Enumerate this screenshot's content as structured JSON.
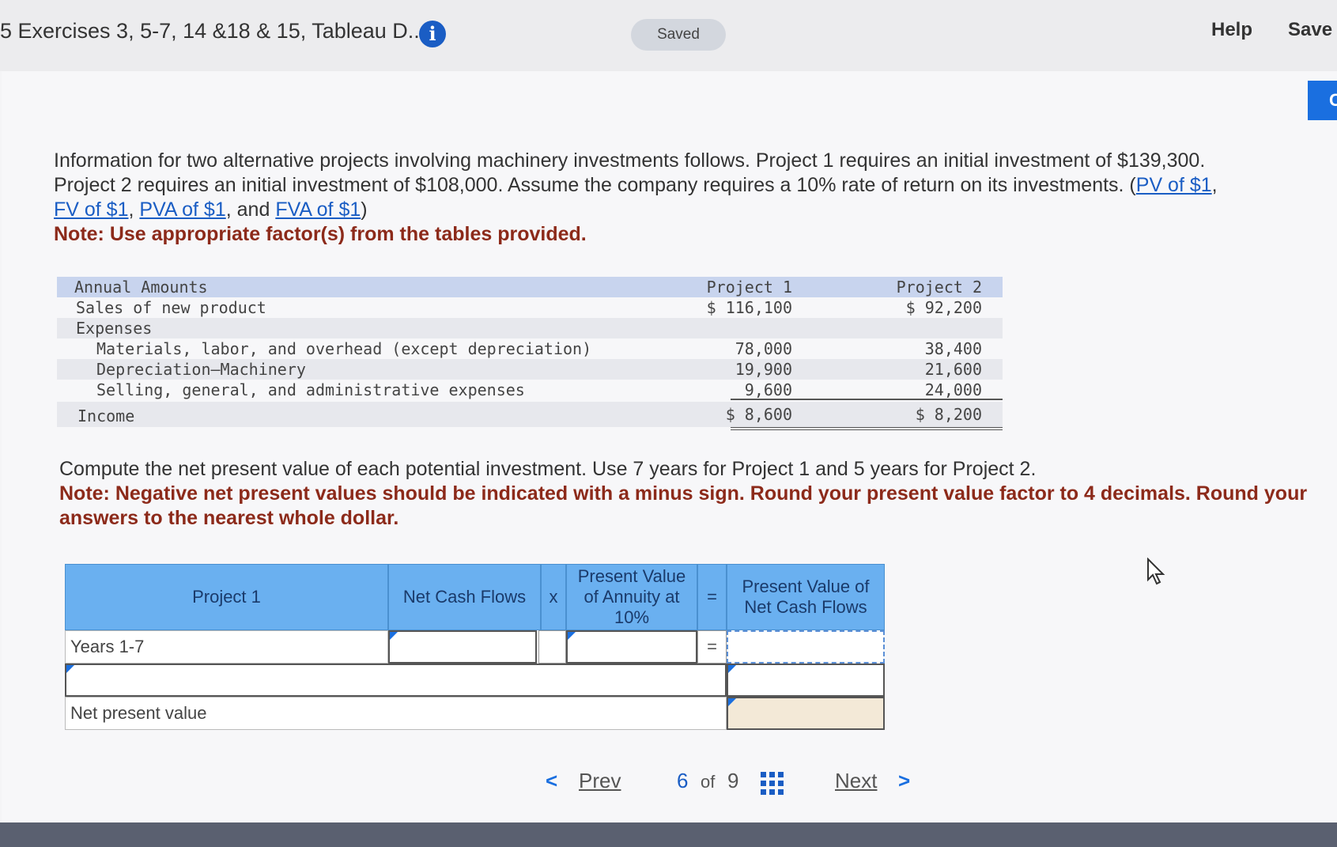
{
  "header": {
    "title": "5 Exercises 3, 5-7, 14 &18 & 15, Tableau D...",
    "saved_label": "Saved",
    "help_label": "Help",
    "save_label": "Save",
    "tab_edge_letter": "C"
  },
  "intro": {
    "text1": "Information for two alternative projects involving machinery investments follows. Project 1 requires an initial investment of $139,300.",
    "text2": "Project 2 requires an initial investment of $108,000. Assume the company requires a 10% rate of return on its investments. (",
    "link_pv": "PV of $1",
    "sep1": ", ",
    "link_fv": "FV of $1",
    "sep2": ", ",
    "link_pva": "PVA of $1",
    "sep3": ", and ",
    "link_fva": "FVA of $1",
    "close": ")",
    "note": "Note: Use appropriate factor(s) from the tables provided."
  },
  "annual_table": {
    "header": {
      "label": "Annual Amounts",
      "col1": "Project 1",
      "col2": "Project 2"
    },
    "rows": [
      {
        "label": "Sales of new product",
        "v1": "$ 116,100",
        "v2": "$ 92,200"
      },
      {
        "label": "Expenses",
        "v1": "",
        "v2": ""
      },
      {
        "label": "Materials, labor, and overhead (except depreciation)",
        "v1": "78,000",
        "v2": "38,400"
      },
      {
        "label": "Depreciation—Machinery",
        "v1": "19,900",
        "v2": "21,600"
      },
      {
        "label": "Selling, general, and administrative expenses",
        "v1": "9,600",
        "v2": "24,000"
      },
      {
        "label": "Income",
        "v1": "$ 8,600",
        "v2": "$ 8,200"
      }
    ]
  },
  "question": {
    "text": "Compute the net present value of each potential investment. Use 7 years for Project 1 and 5 years for Project 2.",
    "note": "Note: Negative net present values should be indicated with a minus sign. Round your present value factor to 4 decimals. Round your answers to the nearest whole dollar."
  },
  "calc_table": {
    "project_header": "Project 1",
    "cash_flows_header": "Net Cash Flows",
    "times_symbol": "x",
    "factor_header": "Present Value of Annuity at 10%",
    "equals_symbol": "=",
    "pv_header": "Present Value of Net Cash Flows",
    "row1_label": "Years 1-7",
    "row3_label": "Net present value",
    "net_cash_flows_value": "",
    "factor_value": "",
    "pv_value": "",
    "row2_label_value": "",
    "row2_pv_value": "",
    "npv_value": ""
  },
  "pager": {
    "prev_label": "Prev",
    "current": "6",
    "of_label": "of",
    "total": "9",
    "next_label": "Next"
  }
}
